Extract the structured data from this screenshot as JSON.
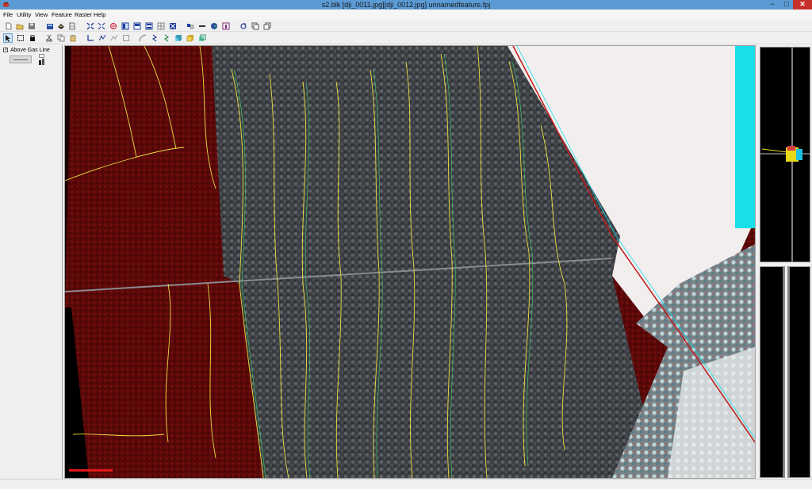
{
  "window": {
    "title": "s2.blk [dji_0011.jpg][dji_0012.jpg]  unnamedfeature.fpj",
    "minimize_glyph": "−",
    "maximize_glyph": "□",
    "close_glyph": "✕"
  },
  "menu": {
    "items": [
      "File",
      "Utility",
      "View",
      "Feature",
      "Raster",
      "Help"
    ]
  },
  "toolbar1": {
    "icons": [
      "new-icon",
      "open-icon",
      "save-icon",
      "open-project-icon",
      "load-icon",
      "erase-icon",
      "page-icon",
      "zoom-extent-icon",
      "zoom-fit-icon",
      "target-icon",
      "layout-single-icon",
      "layout-split-icon",
      "layout-triple-icon",
      "layout-grid-icon",
      "layout-four-icon",
      "swap-icon",
      "ruler-icon",
      "globe-icon",
      "info-icon",
      "refresh-icon",
      "copy-window-icon",
      "tile-window-icon"
    ]
  },
  "toolbar2": {
    "icons": [
      "select-arrow-icon",
      "rectangle-select-icon",
      "lock-icon",
      "cut-icon",
      "copy-icon",
      "paste-icon",
      "axis-icon",
      "node-edit-icon",
      "delete-node-icon",
      "box-icon",
      "curve-icon",
      "break-line-icon",
      "smooth-line-icon",
      "extrude-icon",
      "cube-icon",
      "layer-copy-icon"
    ],
    "pressed": "select-arrow-icon"
  },
  "left_panel": {
    "layer": {
      "label": "Above Gas Line",
      "checked": true,
      "check_glyph": "✓",
      "line_color": "#666666"
    }
  },
  "colors": {
    "titlebar": "#5b9bd5",
    "feature_yellow": "#e8e040",
    "feature_green": "#39d36a",
    "scale_bar": "#e01818"
  },
  "scene": {
    "description_colors": [
      "#5a0808",
      "#3b3d40",
      "#f2eeee",
      "#19e0e8"
    ]
  }
}
